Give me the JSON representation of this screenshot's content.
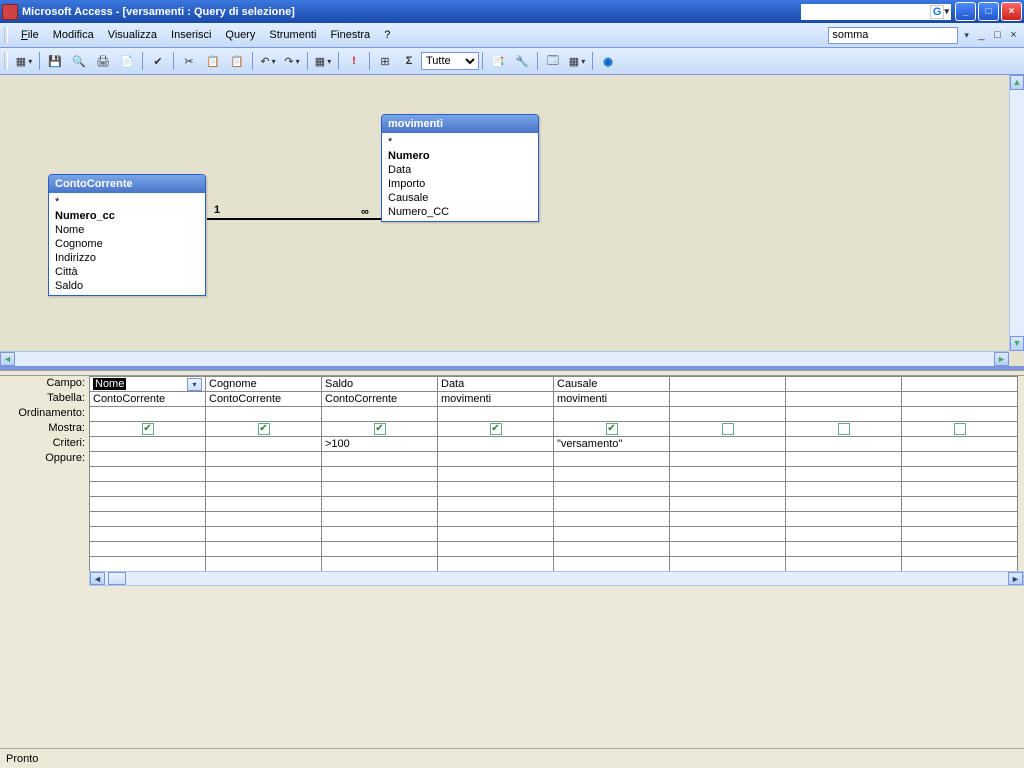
{
  "window": {
    "title": "Microsoft Access - [versamenti : Query di selezione]"
  },
  "menu": {
    "file": "File",
    "modifica": "Modifica",
    "visualizza": "Visualizza",
    "inserisci": "Inserisci",
    "query": "Query",
    "strumenti": "Strumenti",
    "finestra": "Finestra",
    "help": "?"
  },
  "help_input": "somma",
  "toolbar": {
    "tutte": "Tutte"
  },
  "tables": {
    "contoCorrente": {
      "title": "ContoCorrente",
      "fields": [
        "*",
        "Numero_cc",
        "Nome",
        "Cognome",
        "Indirizzo",
        "Città",
        "Saldo"
      ],
      "bold": [
        false,
        true,
        false,
        false,
        false,
        false,
        false
      ]
    },
    "movimenti": {
      "title": "movimenti",
      "fields": [
        "*",
        "Numero",
        "Data",
        "Importo",
        "Causale",
        "Numero_CC"
      ],
      "bold": [
        false,
        true,
        false,
        false,
        false,
        false
      ]
    }
  },
  "relation": {
    "left": "1",
    "right": "∞"
  },
  "rows": {
    "labels": [
      "Campo:",
      "Tabella:",
      "Ordinamento:",
      "Mostra:",
      "Criteri:",
      "Oppure:"
    ],
    "cols": [
      {
        "campo": "Nome",
        "tabella": "ContoCorrente",
        "mostra": true,
        "criteri": "",
        "selected": true
      },
      {
        "campo": "Cognome",
        "tabella": "ContoCorrente",
        "mostra": true,
        "criteri": ""
      },
      {
        "campo": "Saldo",
        "tabella": "ContoCorrente",
        "mostra": true,
        "criteri": ">100"
      },
      {
        "campo": "Data",
        "tabella": "movimenti",
        "mostra": true,
        "criteri": ""
      },
      {
        "campo": "Causale",
        "tabella": "movimenti",
        "mostra": true,
        "criteri": "\"versamento\""
      },
      {
        "campo": "",
        "tabella": "",
        "mostra": false,
        "criteri": ""
      },
      {
        "campo": "",
        "tabella": "",
        "mostra": false,
        "criteri": ""
      },
      {
        "campo": "",
        "tabella": "",
        "mostra": false,
        "criteri": ""
      }
    ]
  },
  "status": "Pronto"
}
